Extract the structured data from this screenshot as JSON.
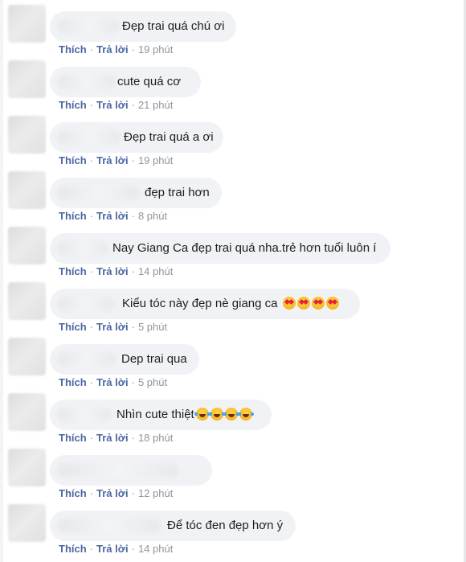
{
  "actions": {
    "like_label": "Thích",
    "reply_label": "Trả lời",
    "separator": "·"
  },
  "comments": [
    {
      "text": "Đẹp trai quá chú ơi",
      "time": "19 phút",
      "emojis": []
    },
    {
      "text": "cute quá cơ",
      "time": "21 phút",
      "emojis": []
    },
    {
      "text": "Đẹp trai quá a ơi",
      "time": "19 phút",
      "emojis": []
    },
    {
      "text": "đẹp trai hơn",
      "time": "8 phút",
      "emojis": []
    },
    {
      "text": "Nay Giang Ca đẹp trai quá nha.trẻ hơn tuổi luôn í",
      "time": "14 phút",
      "emojis": []
    },
    {
      "text": "Kiểu tóc này đẹp nè giang ca",
      "time": "5 phút",
      "emojis": [
        "smiling-face-with-heart-eyes-icon",
        "smiling-face-with-heart-eyes-icon",
        "smiling-face-with-heart-eyes-icon",
        "smiling-face-with-heart-eyes-icon"
      ]
    },
    {
      "text": "Dep trai qua",
      "time": "5 phút",
      "emojis": []
    },
    {
      "text": "Nhìn cute thiệt",
      "time": "18 phút",
      "emojis": [
        "face-with-tears-of-joy-icon",
        "face-with-tears-of-joy-icon",
        "face-with-tears-of-joy-icon",
        "face-with-tears-of-joy-icon"
      ]
    },
    {
      "text": "",
      "time": "12 phút",
      "emojis": []
    },
    {
      "text": "Để tóc đen đẹp hơn ý",
      "time": "14 phút",
      "emojis": []
    }
  ],
  "colors": {
    "bubble": "#f0f2f5",
    "action_link": "#4b67a1",
    "timestamp": "#90949c",
    "text": "#1c1e21"
  }
}
